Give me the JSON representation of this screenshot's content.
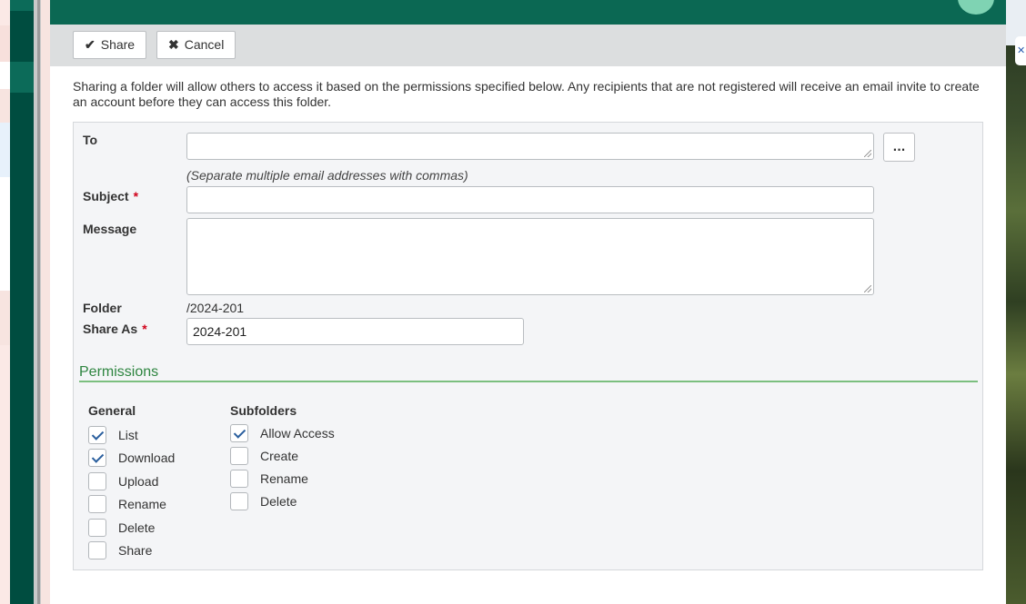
{
  "toolbar": {
    "share_label": "Share",
    "cancel_label": "Cancel"
  },
  "intro_text": "Sharing a folder will allow others to access it based on the permissions specified below. Any recipients that are not registered will receive an email invite to create an account before they can access this folder.",
  "form": {
    "to_label": "To",
    "to_value": "",
    "to_hint": "(Separate multiple email addresses with commas)",
    "more_label": "...",
    "subject_label": "Subject",
    "subject_value": "",
    "message_label": "Message",
    "message_value": "",
    "folder_label": "Folder",
    "folder_value": "/2024-201",
    "share_as_label": "Share As",
    "share_as_value": "2024-201",
    "required_marker": "*"
  },
  "permissions": {
    "title": "Permissions",
    "general": {
      "title": "General",
      "items": [
        {
          "label": "List",
          "checked": true
        },
        {
          "label": "Download",
          "checked": true
        },
        {
          "label": "Upload",
          "checked": false
        },
        {
          "label": "Rename",
          "checked": false
        },
        {
          "label": "Delete",
          "checked": false
        },
        {
          "label": "Share",
          "checked": false
        }
      ]
    },
    "subfolders": {
      "title": "Subfolders",
      "items": [
        {
          "label": "Allow Access",
          "checked": true
        },
        {
          "label": "Create",
          "checked": false
        },
        {
          "label": "Rename",
          "checked": false
        },
        {
          "label": "Delete",
          "checked": false
        }
      ]
    }
  },
  "icons": {
    "share": "check-icon",
    "cancel": "x-icon",
    "close": "close-icon"
  },
  "colors": {
    "header": "#0b6853",
    "accent_green": "#2e8540",
    "required": "#d0021b"
  }
}
